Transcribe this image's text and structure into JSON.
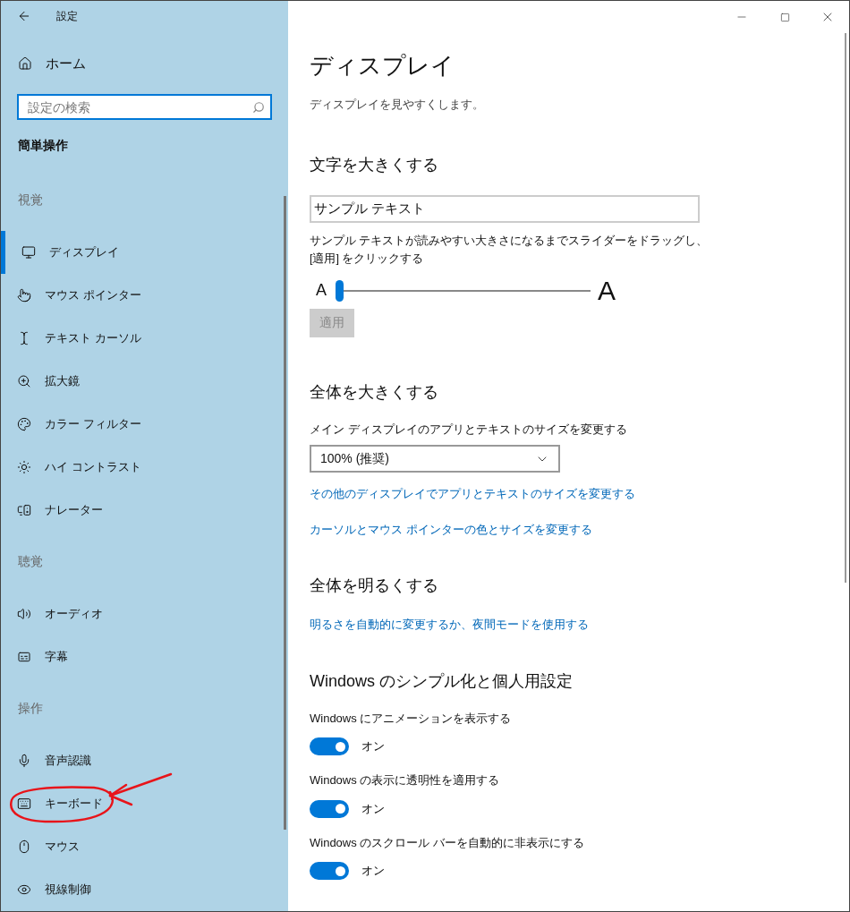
{
  "window": {
    "title": "設定"
  },
  "sidebar": {
    "home": "ホーム",
    "search": {
      "placeholder": "設定の検索"
    },
    "section_title": "簡単操作",
    "groups": [
      {
        "heading": "視覚",
        "items": [
          {
            "label": "ディスプレイ",
            "selected": true
          },
          {
            "label": "マウス ポインター",
            "selected": false
          },
          {
            "label": "テキスト カーソル",
            "selected": false
          },
          {
            "label": "拡大鏡",
            "selected": false
          },
          {
            "label": "カラー フィルター",
            "selected": false
          },
          {
            "label": "ハイ コントラスト",
            "selected": false
          },
          {
            "label": "ナレーター",
            "selected": false
          }
        ]
      },
      {
        "heading": "聴覚",
        "items": [
          {
            "label": "オーディオ",
            "selected": false
          },
          {
            "label": "字幕",
            "selected": false
          }
        ]
      },
      {
        "heading": "操作",
        "items": [
          {
            "label": "音声認識",
            "selected": false
          },
          {
            "label": "キーボード",
            "selected": false
          },
          {
            "label": "マウス",
            "selected": false
          },
          {
            "label": "視線制御",
            "selected": false
          }
        ]
      }
    ]
  },
  "main": {
    "title": "ディスプレイ",
    "subtitle": "ディスプレイを見やすくします。",
    "text_size": {
      "heading": "文字を大きくする",
      "sample": {
        "value": "サンプル テキスト"
      },
      "description": "サンプル テキストが読みやすい大きさになるまでスライダーをドラッグし、[適用] をクリックする",
      "slider": {
        "small_label": "A",
        "large_label": "A",
        "level": 0
      },
      "apply_button": {
        "label": "適用",
        "disabled": true
      }
    },
    "scale": {
      "heading": "全体を大きくする",
      "label": "メイン ディスプレイのアプリとテキストのサイズを変更する",
      "dropdown": {
        "value": "100% (推奨)"
      },
      "links": [
        "その他のディスプレイでアプリとテキストのサイズを変更する",
        "カーソルとマウス ポインターの色とサイズを変更する"
      ]
    },
    "brightness": {
      "heading": "全体を明るくする",
      "links": [
        "明るさを自動的に変更するか、夜間モードを使用する"
      ]
    },
    "simplify": {
      "heading": "Windows のシンプル化と個人用設定",
      "toggles": [
        {
          "label": "Windows にアニメーションを表示する",
          "on": true,
          "state_text": "オン"
        },
        {
          "label": "Windows の表示に透明性を適用する",
          "on": true,
          "state_text": "オン"
        },
        {
          "label": "Windows のスクロール バーを自動的に非表示にする",
          "on": true,
          "state_text": "オン"
        }
      ]
    }
  }
}
